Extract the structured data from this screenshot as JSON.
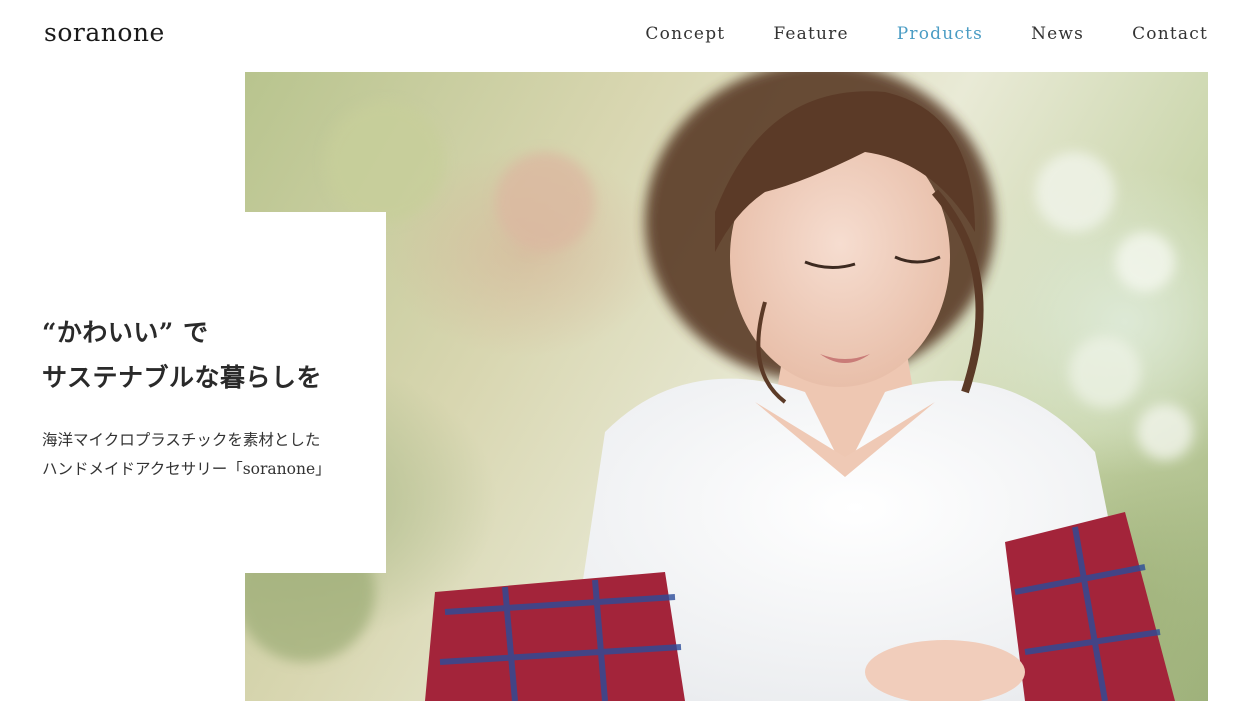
{
  "brand": {
    "logo": "soranone"
  },
  "nav": {
    "items": [
      {
        "label": "Concept",
        "active": false
      },
      {
        "label": "Feature",
        "active": false
      },
      {
        "label": "Products",
        "active": true
      },
      {
        "label": "News",
        "active": false
      },
      {
        "label": "Contact",
        "active": false
      }
    ]
  },
  "hero": {
    "headline_line1": "“かわいい” で",
    "headline_line2": "サステナブルな暮らしを",
    "description_line1": "海洋マイクロプラスチックを素材とした",
    "description_line2": "ハンドメイドアクセサリー「soranone」",
    "image_subject": "woman in white fluffy sweater with red plaid scarf"
  },
  "colors": {
    "nav_active": "#4a9cc4",
    "text": "#2a2a2a",
    "background": "#ffffff"
  }
}
